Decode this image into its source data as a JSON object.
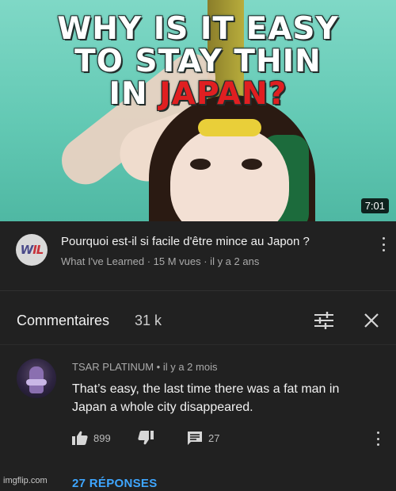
{
  "thumbnail": {
    "headline_line1": "WHY IS IT EASY",
    "headline_line2": "TO STAY THIN",
    "headline_line3_prefix": "IN ",
    "headline_line3_highlight": "JAPAN?",
    "duration": "7:01",
    "highlight_color": "#e01f21"
  },
  "video": {
    "channel_avatar_text_a": "W",
    "channel_avatar_text_b": "IL",
    "title": "Pourquoi est-il si facile d'être mince au Japon ?",
    "meta": "What I've Learned · 15 M vues · il y a 2 ans",
    "menu_icon": "more-vert-icon"
  },
  "comments": {
    "title": "Commentaires",
    "count": "31 k",
    "sort_icon": "tune-icon",
    "close_icon": "close-icon"
  },
  "comment": {
    "author_line": "TSAR PLATINUM • il y a 2 mois",
    "text": "That’s easy, the last time there was a fat man in Japan a whole city disappeared.",
    "likes": "899",
    "replies_count": "27",
    "replies_link": "27 RÉPONSES",
    "link_color": "#3ea6ff"
  },
  "watermark": "imgflip.com"
}
